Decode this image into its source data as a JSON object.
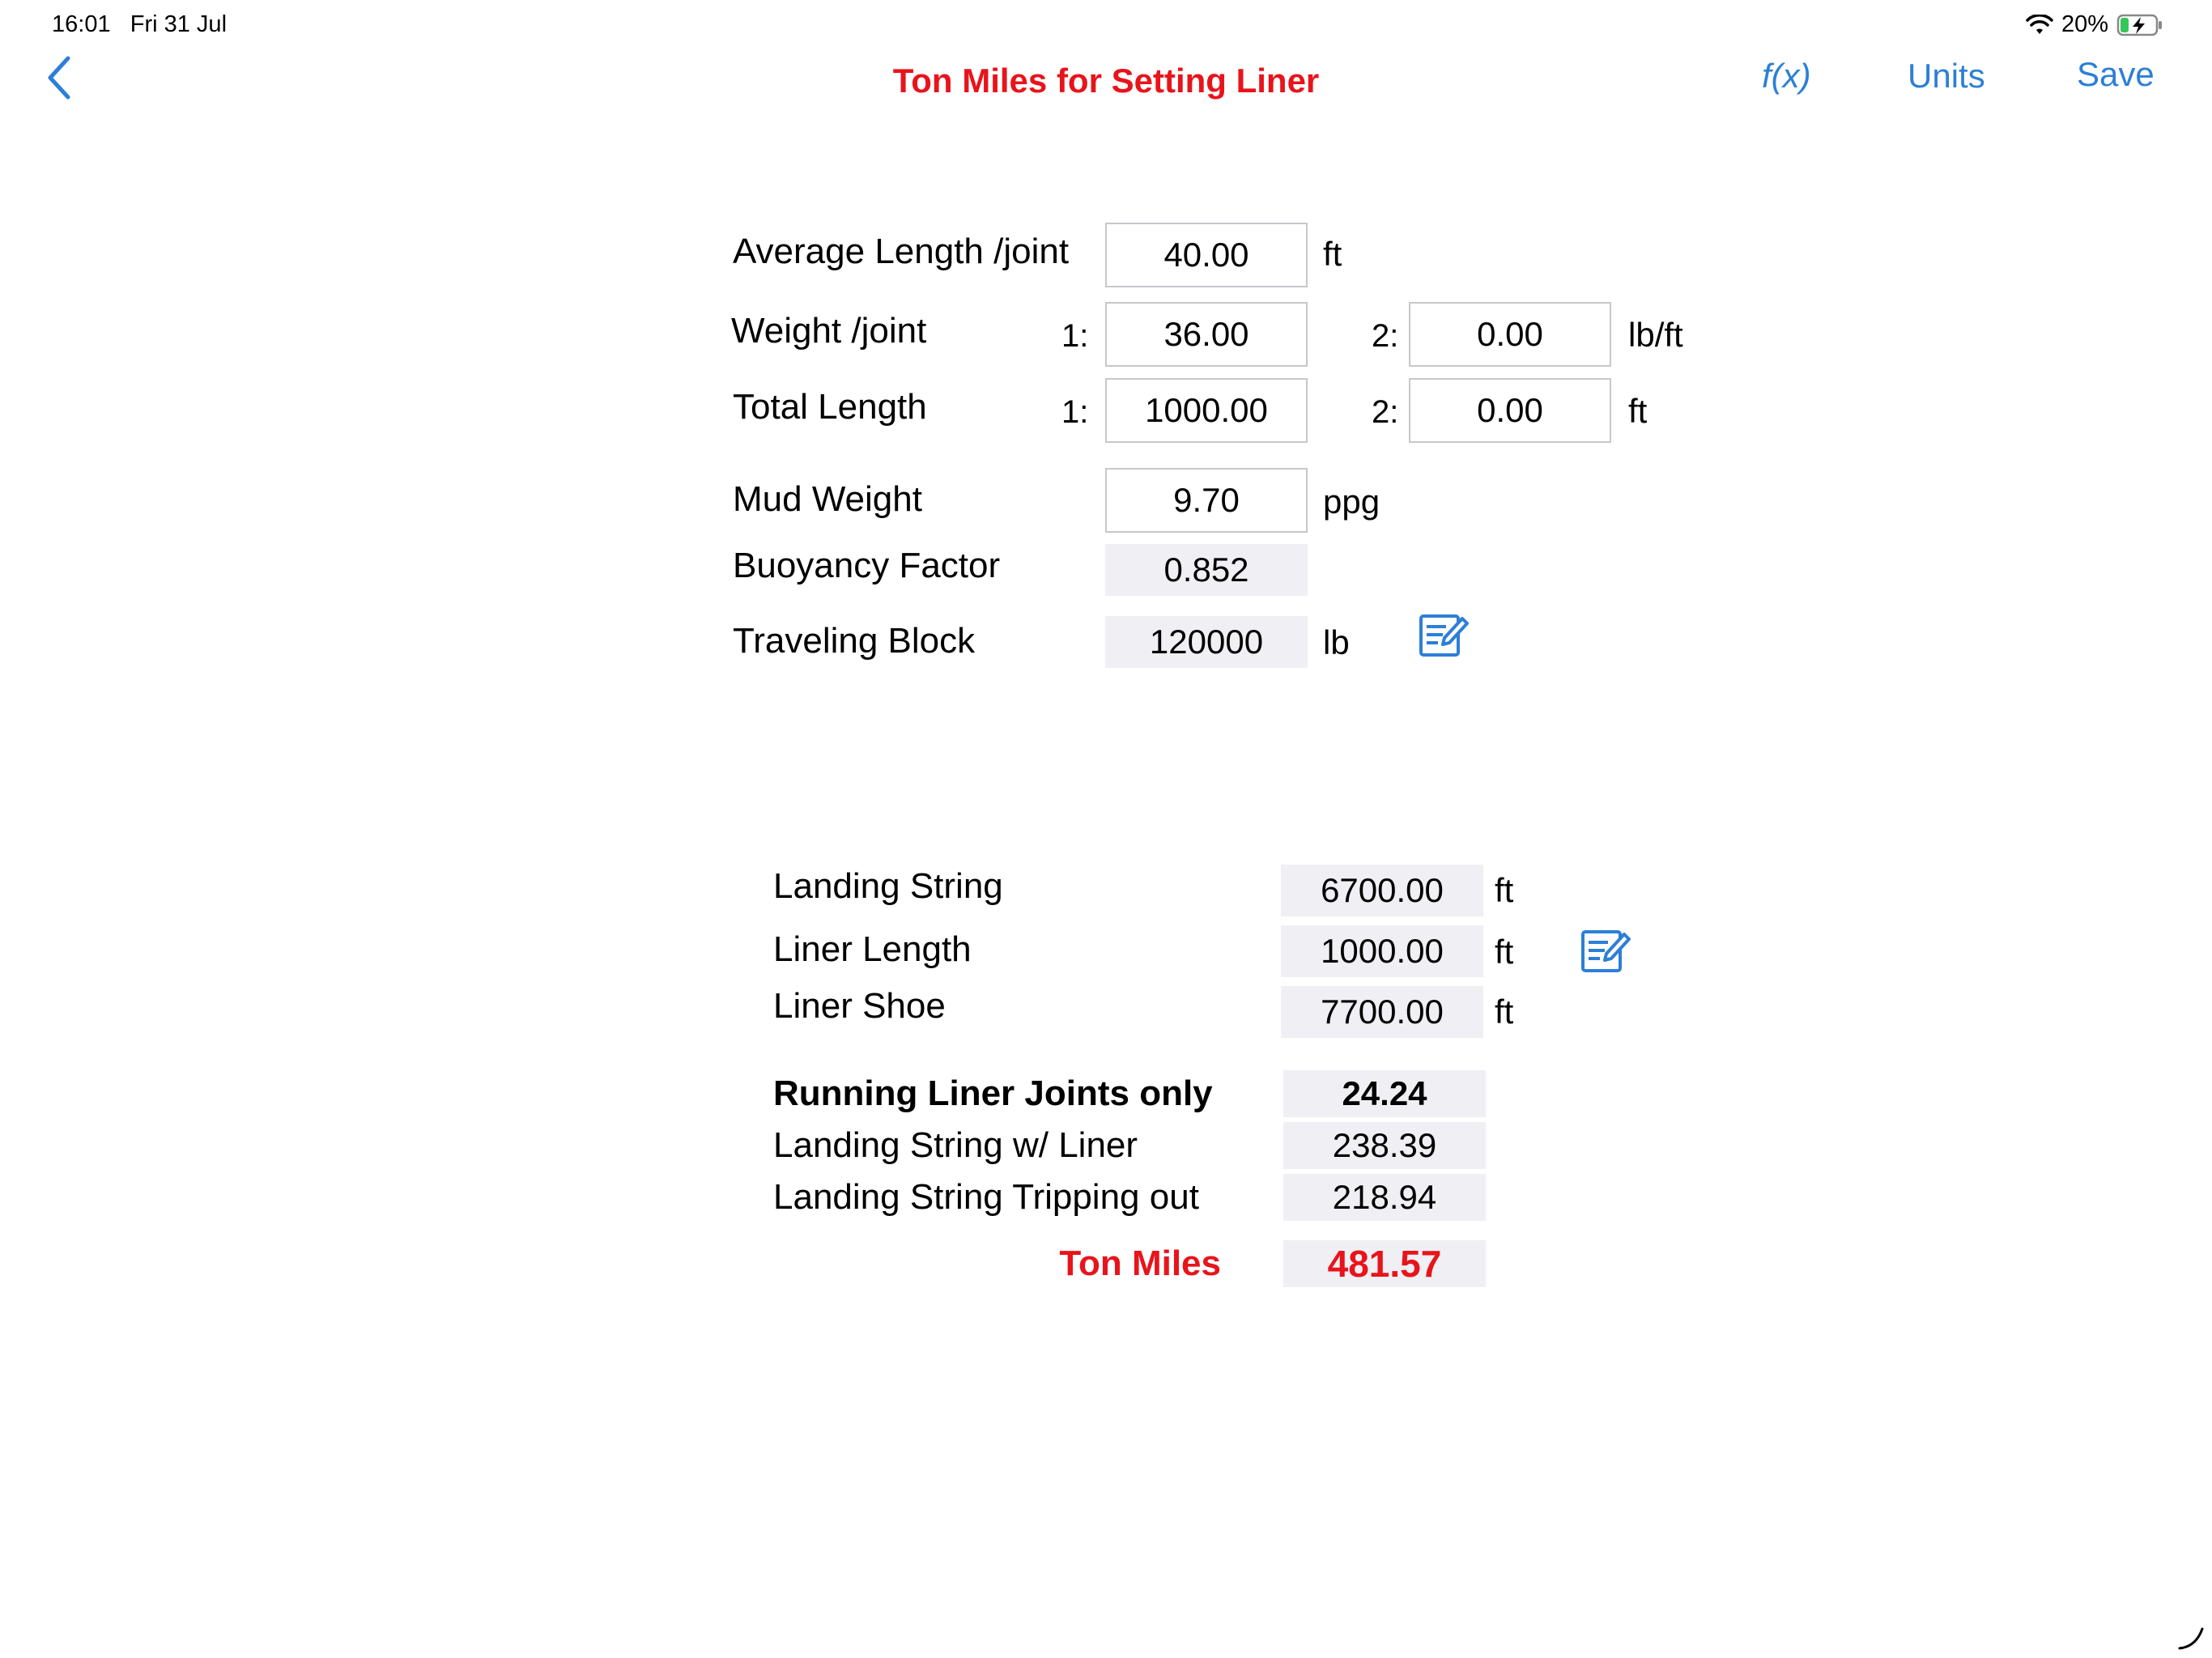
{
  "status_bar": {
    "time": "16:01",
    "date": "Fri 31 Jul",
    "battery": "20%"
  },
  "nav": {
    "title": "Ton Miles for Setting Liner",
    "fx": "f(x)",
    "units": "Units",
    "save": "Save"
  },
  "inputs": {
    "avg_length": {
      "label": "Average Length /joint",
      "value": "40.00",
      "unit": "ft"
    },
    "weight": {
      "label": "Weight /joint",
      "idx1": "1:",
      "value1": "36.00",
      "idx2": "2:",
      "value2": "0.00",
      "unit": "lb/ft"
    },
    "total_length": {
      "label": "Total Length",
      "idx1": "1:",
      "value1": "1000.00",
      "idx2": "2:",
      "value2": "0.00",
      "unit": "ft"
    },
    "mud_weight": {
      "label": "Mud Weight",
      "value": "9.70",
      "unit": "ppg"
    },
    "buoyancy": {
      "label": "Buoyancy Factor",
      "value": "0.852"
    },
    "traveling_block": {
      "label": "Traveling Block",
      "value": "120000",
      "unit": "lb"
    }
  },
  "depths": {
    "landing_string": {
      "label": "Landing String",
      "value": "6700.00",
      "unit": "ft"
    },
    "liner_length": {
      "label": "Liner Length",
      "value": "1000.00",
      "unit": "ft"
    },
    "liner_shoe": {
      "label": "Liner Shoe",
      "value": "7700.00",
      "unit": "ft"
    }
  },
  "results": {
    "running_liner": {
      "label": "Running Liner Joints only",
      "value": "24.24"
    },
    "landing_with_liner": {
      "label": "Landing String w/ Liner",
      "value": "238.39"
    },
    "tripping_out": {
      "label": "Landing String Tripping out",
      "value": "218.94"
    },
    "ton_miles": {
      "label": "Ton Miles",
      "value": "481.57"
    }
  },
  "colors": {
    "accent": "#2d7fd6",
    "title_red": "#e8141b",
    "readout_bg": "#efeff4"
  },
  "icons": [
    "chevron-left-icon",
    "wifi-icon",
    "battery-charging-icon",
    "edit-note-icon"
  ]
}
